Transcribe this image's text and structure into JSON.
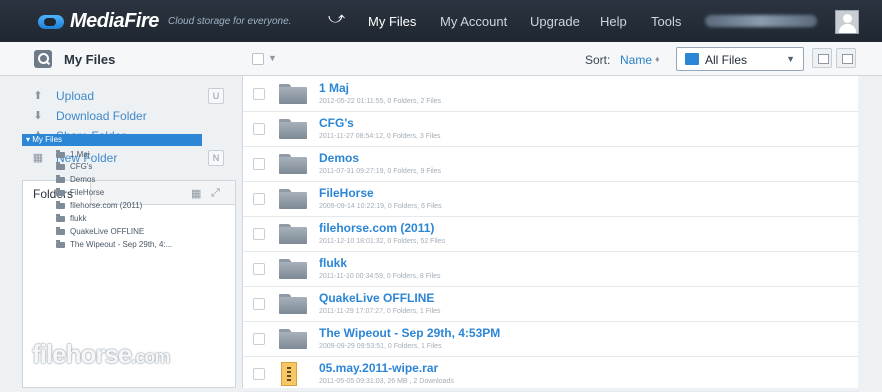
{
  "brand": {
    "name": "MediaFire",
    "tagline": "Cloud storage for everyone."
  },
  "nav": {
    "items": [
      "My Files",
      "My Account",
      "Upgrade",
      "Help",
      "Tools"
    ]
  },
  "toolbar": {
    "title": "My Files",
    "sort_label": "Sort:",
    "sort_value": "Name",
    "filter_value": "All Files"
  },
  "actions": [
    {
      "label": "Upload",
      "shortcut": "U",
      "icon": "upload-icon"
    },
    {
      "label": "Download Folder",
      "shortcut": "",
      "icon": "download-icon"
    },
    {
      "label": "Share Folder",
      "shortcut": "",
      "icon": "share-icon"
    },
    {
      "label": "New Folder",
      "shortcut": "N",
      "icon": "new-folder-icon"
    }
  ],
  "folders_tab": "Folders",
  "tree": {
    "root": "My Files",
    "items": [
      "1 Maj",
      "CFG's",
      "Demos",
      "FileHorse",
      "filehorse.com (2011)",
      "flukk",
      "QuakeLive OFFLINE",
      "The Wipeout - Sep 29th, 4:..."
    ]
  },
  "files": [
    {
      "name": "1 Maj",
      "meta": "2012-05-22 01:11:55, 0 Folders, 2 Files",
      "type": "folder"
    },
    {
      "name": "CFG's",
      "meta": "2011-11-27 08:54:12, 0 Folders, 3 Files",
      "type": "folder"
    },
    {
      "name": "Demos",
      "meta": "2011-07-31 09:27:19, 0 Folders, 9 Files",
      "type": "folder"
    },
    {
      "name": "FileHorse",
      "meta": "2009-09-14 10:22:19, 0 Folders, 6 Files",
      "type": "folder"
    },
    {
      "name": "filehorse.com (2011)",
      "meta": "2011-12-10 18:01:32, 0 Folders, 52 Files",
      "type": "folder"
    },
    {
      "name": "flukk",
      "meta": "2011-11-10 00:34:59, 0 Folders, 8 Files",
      "type": "folder"
    },
    {
      "name": "QuakeLive OFFLINE",
      "meta": "2011-11-29 17:07:27, 0 Folders, 1 Files",
      "type": "folder"
    },
    {
      "name": "The Wipeout - Sep 29th, 4:53PM",
      "meta": "2009-09-29 09:53:51, 0 Folders, 1 Files",
      "type": "folder"
    },
    {
      "name": "05.may.2011-wipe.rar",
      "meta": "2011-05-05 09:31:03, 26 MB , 2 Downloads",
      "type": "archive"
    }
  ],
  "watermark": {
    "main": "filehorse",
    "suffix": ".com"
  }
}
